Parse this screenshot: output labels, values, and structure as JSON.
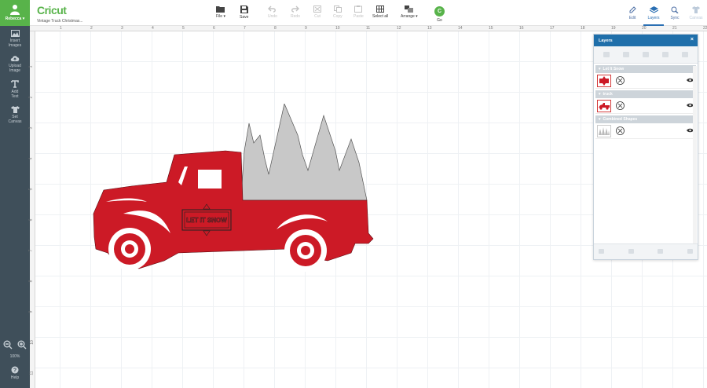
{
  "app": {
    "logo": "Cricut",
    "project_name": "Vintage Truck Christmas..."
  },
  "user": {
    "name": "Rebecca ▾"
  },
  "sidebar": {
    "items": [
      {
        "label1": "Insert",
        "label2": "Images",
        "icon": "image-icon"
      },
      {
        "label1": "Upload",
        "label2": "Image",
        "icon": "cloud-upload-icon"
      },
      {
        "label1": "Add",
        "label2": "Text",
        "icon": "text-icon"
      },
      {
        "label1": "Set",
        "label2": "Canvas",
        "icon": "shirt-icon"
      }
    ],
    "zoom": "100%",
    "help": "Help"
  },
  "toolbar": {
    "file": "File ▾",
    "save": "Save",
    "undo": "Undo",
    "redo": "Redo",
    "cut": "Cut",
    "copy": "Copy",
    "paste": "Paste",
    "select_all": "Select all",
    "arrange": "Arrange ▾",
    "go": "Go",
    "go_letter": "C"
  },
  "tabs": {
    "edit": "Edit",
    "layers": "Layers",
    "sync": "Sync",
    "canvas": "Canvas"
  },
  "ruler": {
    "top": [
      "1",
      "2",
      "3",
      "4",
      "5",
      "6",
      "7",
      "8",
      "9",
      "10",
      "11",
      "12",
      "13",
      "14",
      "15",
      "16",
      "17",
      "18",
      "19",
      "20",
      "21",
      "22"
    ],
    "left": [
      "1",
      "2",
      "3",
      "4",
      "5",
      "6",
      "7",
      "8",
      "9",
      "10",
      "11"
    ]
  },
  "design": {
    "sign_text": "LET IT SNOW"
  },
  "layers_panel": {
    "title": "Layers",
    "close": "×",
    "groups": [
      {
        "name": "Let It Snow",
        "thumb": "snow-sign"
      },
      {
        "name": "truck",
        "thumb": "truck"
      },
      {
        "name": "Combined Shapes",
        "thumb": "trees"
      }
    ]
  },
  "colors": {
    "brand": "#58b34a",
    "truck": "#cc1a26",
    "trees": "#c8c8c8",
    "panel_header": "#1f6faa"
  }
}
